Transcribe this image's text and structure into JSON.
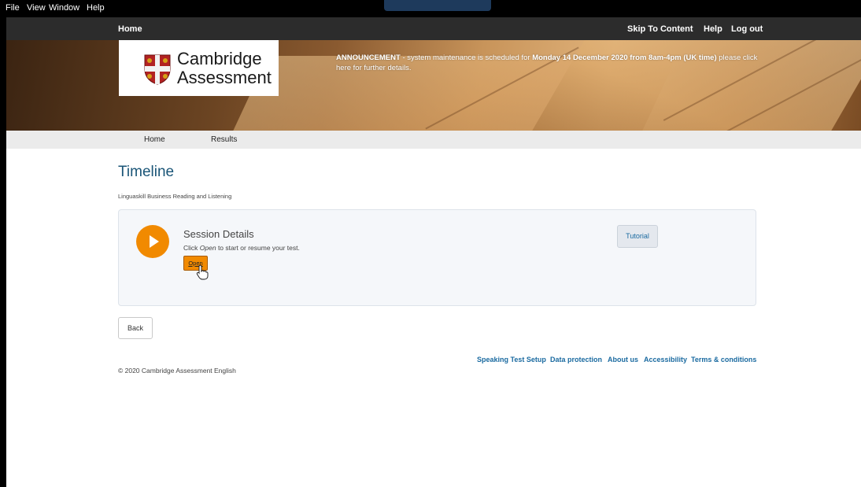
{
  "os_menu": {
    "file": "File",
    "view": "View",
    "window": "Window",
    "help": "Help"
  },
  "topbar": {
    "home": "Home",
    "skip": "Skip To Content",
    "help": "Help",
    "logout": "Log out"
  },
  "logo": {
    "line1": "Cambridge",
    "line2": "Assessment"
  },
  "announcement": {
    "label": "ANNOUNCEMENT",
    "text_before": " - system maintenance is scheduled for ",
    "highlight": "Monday 14 December 2020 from 8am-4pm (UK time)",
    "text_after": " please click here for further details."
  },
  "nav": {
    "home": "Home",
    "results": "Results"
  },
  "page": {
    "title": "Timeline",
    "subtitle": "Linguaskill Business Reading and Listening"
  },
  "session": {
    "title": "Session Details",
    "desc_before": "Click ",
    "desc_em": "Open",
    "desc_after": " to start or resume your test.",
    "open_label": "Open",
    "tutorial_label": "Tutorial"
  },
  "back_label": "Back",
  "footer": {
    "links": [
      "Speaking Test Setup",
      "Data protection",
      "About us",
      "Accessibility",
      "Terms & conditions"
    ],
    "copyright": "© 2020 Cambridge Assessment English"
  },
  "colors": {
    "accent": "#f18a00",
    "link": "#1a6aa0",
    "title": "#1a5577"
  }
}
